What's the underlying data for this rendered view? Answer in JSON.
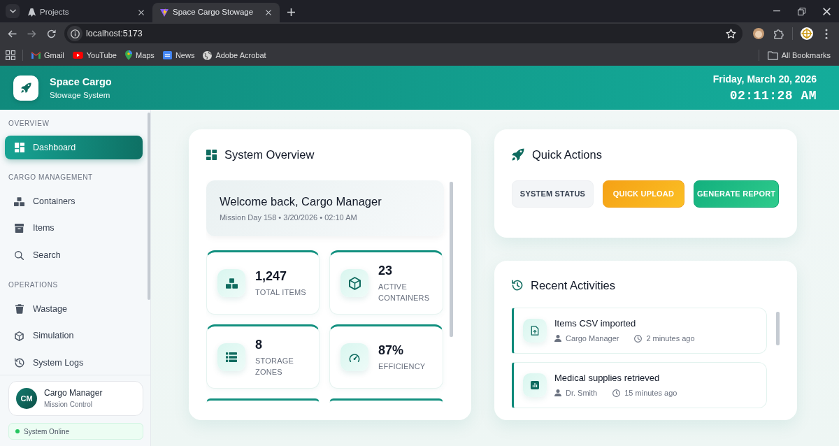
{
  "browser": {
    "tabs": [
      {
        "title": "Projects",
        "selected": false
      },
      {
        "title": "Space Cargo Stowage",
        "selected": true
      }
    ],
    "address": "localhost:5173",
    "bookmarks": [
      {
        "label": "Gmail"
      },
      {
        "label": "YouTube"
      },
      {
        "label": "Maps"
      },
      {
        "label": "News"
      },
      {
        "label": "Adobe Acrobat"
      }
    ],
    "all_bookmarks": "All Bookmarks"
  },
  "header": {
    "title": "Space Cargo",
    "subtitle": "Stowage System",
    "date": "Friday, March 20, 2026",
    "time": "02:11:28 AM"
  },
  "sidebar": {
    "sections": [
      {
        "heading": "OVERVIEW",
        "items": [
          {
            "label": "Dashboard",
            "selected": true
          }
        ]
      },
      {
        "heading": "CARGO MANAGEMENT",
        "items": [
          {
            "label": "Containers",
            "selected": false
          },
          {
            "label": "Items",
            "selected": false
          },
          {
            "label": "Search",
            "selected": false
          }
        ]
      },
      {
        "heading": "OPERATIONS",
        "items": [
          {
            "label": "Wastage",
            "selected": false
          },
          {
            "label": "Simulation",
            "selected": false
          },
          {
            "label": "System Logs",
            "selected": false
          }
        ]
      }
    ],
    "user": {
      "initials": "CM",
      "name": "Cargo Manager",
      "role": "Mission Control"
    },
    "status": "System Online"
  },
  "overview": {
    "title": "System Overview",
    "welcome": {
      "title": "Welcome back, Cargo Manager",
      "subtitle": "Mission Day 158 • 3/20/2026 • 02:10 AM"
    },
    "stats": [
      {
        "value": "1,247",
        "label": "TOTAL ITEMS"
      },
      {
        "value": "23",
        "label": "ACTIVE CONTAINERS"
      },
      {
        "value": "8",
        "label": "STORAGE ZONES"
      },
      {
        "value": "87%",
        "label": "EFFICIENCY"
      }
    ]
  },
  "quick_actions": {
    "title": "Quick Actions",
    "buttons": [
      {
        "label": "SYSTEM STATUS",
        "kind": "neutral"
      },
      {
        "label": "QUICK UPLOAD",
        "kind": "warning"
      },
      {
        "label": "GENERATE REPORT",
        "kind": "success"
      }
    ]
  },
  "recent_activities": {
    "title": "Recent Activities",
    "items": [
      {
        "title": "Items CSV imported",
        "user": "Cargo Manager",
        "time": "2 minutes ago"
      },
      {
        "title": "Medical supplies retrieved",
        "user": "Dr. Smith",
        "time": "15 minutes ago"
      }
    ]
  }
}
